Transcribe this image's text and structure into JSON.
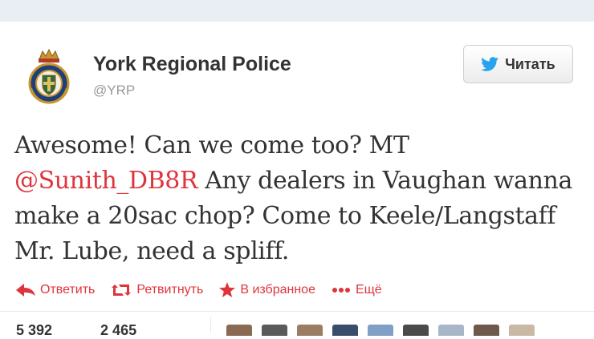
{
  "tweet": {
    "display_name": "York Regional Police",
    "handle": "@YRP",
    "follow_label": "Читать",
    "text_prefix": "Awesome! Can we come too? MT ",
    "mention": "@Sunith_DB8R",
    "text_body": " Any dealers in Vaughan wanna make a 20sac chop? Come to Keele/Langstaff  Mr. Lube, need a spliff.",
    "actions": {
      "reply": "Ответить",
      "retweet": "Ретвитнуть",
      "favorite": "В избранное",
      "more": "Ещё"
    },
    "stats": {
      "retweets": "5 392",
      "favorites": "2 465"
    }
  },
  "colors": {
    "accent": "#e0343d",
    "text": "#333333",
    "muted": "#999999",
    "top_band": "#e9eef5",
    "twitter_blue": "#2aa3ef"
  },
  "icons": [
    "police-crest-icon",
    "twitter-bird-icon",
    "reply-arrow-icon",
    "retweet-icon",
    "star-icon",
    "more-dots-icon"
  ],
  "avatars_row_count": 9
}
